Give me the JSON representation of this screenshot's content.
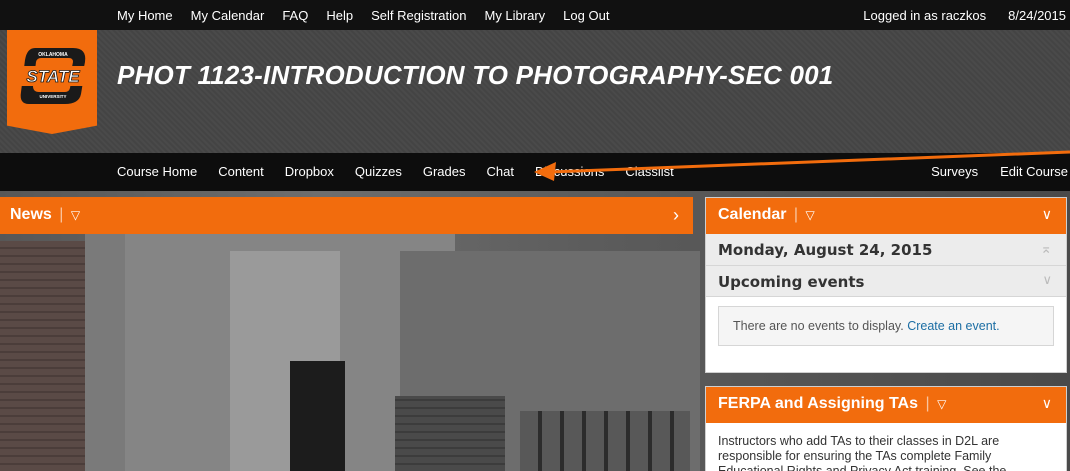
{
  "topbar": {
    "links": [
      "My Home",
      "My Calendar",
      "FAQ",
      "Help",
      "Self Registration",
      "My Library",
      "Log Out"
    ],
    "logged_in": "Logged in as raczkos",
    "date": "8/24/2015"
  },
  "logo": {
    "name": "OKLAHOMA STATE UNIVERSITY"
  },
  "header": {
    "course_title": "PHOT 1123-INTRODUCTION TO PHOTOGRAPHY-SEC 001"
  },
  "coursenav": {
    "left_items": [
      "Course Home",
      "Content",
      "Dropbox",
      "Quizzes",
      "Grades",
      "Chat",
      "Discussions",
      "Classlist"
    ],
    "right_items": [
      "Surveys",
      "Edit Course"
    ]
  },
  "news": {
    "title": "News"
  },
  "calendar": {
    "title": "Calendar",
    "date": "Monday, August 24, 2015",
    "upcoming_label": "Upcoming events",
    "empty_text": "There are no events to display.",
    "create_link": "Create an event."
  },
  "ferpa": {
    "title": "FERPA and Assigning TAs",
    "body": "Instructors who add TAs to their classes in D2L are responsible for ensuring the TAs complete Family Educational Rights and Privacy Act training. See the"
  },
  "colors": {
    "accent": "#f26c0d",
    "topbar": "#111111",
    "nav": "#0d0d0d",
    "link": "#1c6ea4"
  },
  "icons": [
    "chevron-right-icon",
    "chevron-down-icon",
    "menu-toggle-icon",
    "osu-logo",
    "annotation-arrow"
  ]
}
